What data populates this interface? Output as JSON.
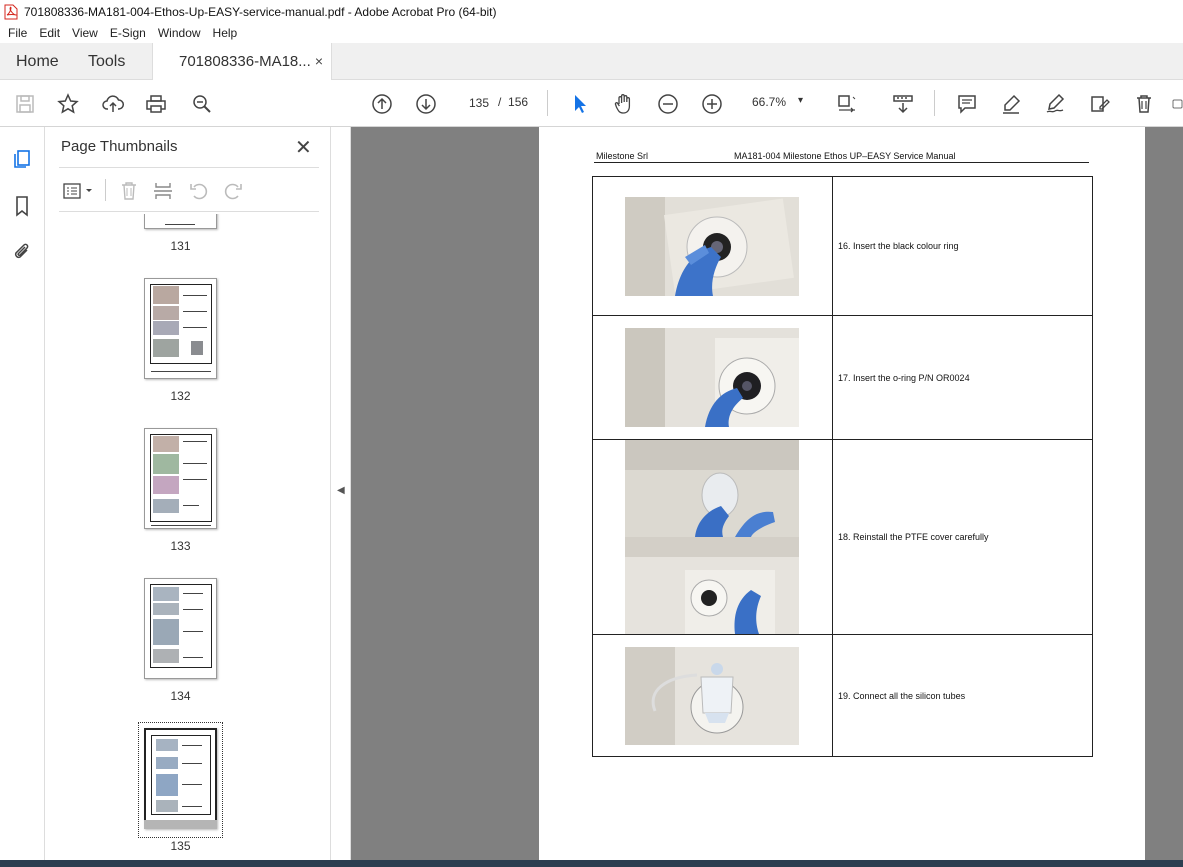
{
  "window": {
    "title": "701808336-MA181-004-Ethos-Up-EASY-service-manual.pdf - Adobe Acrobat Pro (64-bit)"
  },
  "menu": [
    "File",
    "Edit",
    "View",
    "E-Sign",
    "Window",
    "Help"
  ],
  "tabs": {
    "home": "Home",
    "tools": "Tools",
    "document": "701808336-MA18...",
    "close_glyph": "×"
  },
  "toolbar": {
    "current_page": "135",
    "page_separator": "/",
    "total_pages": "156",
    "zoom": "66.7%",
    "zoom_dropdown": "▾"
  },
  "thumbnails_panel": {
    "title": "Page Thumbnails",
    "close_glyph": "✕",
    "pages": [
      {
        "label": "131",
        "selected": false
      },
      {
        "label": "132",
        "selected": false
      },
      {
        "label": "133",
        "selected": false
      },
      {
        "label": "134",
        "selected": false
      },
      {
        "label": "135",
        "selected": true
      }
    ]
  },
  "document": {
    "header_left": "Milestone Srl",
    "header_center": "MA181-004 Milestone Ethos UP–EASY Service Manual",
    "steps": [
      {
        "text": "16.  Insert the black colour ring"
      },
      {
        "text": "17.  Insert the o-ring P/N OR0024"
      },
      {
        "text": "18.  Reinstall the PTFE cover carefully"
      },
      {
        "text": "19.  Connect all the silicon tubes"
      }
    ]
  },
  "icons": {
    "save": "save-icon",
    "bookmark": "star-icon",
    "upload": "upload-icon",
    "print": "print-icon",
    "search": "search-zoom-icon",
    "prev_page": "arrow-up-circle-icon",
    "next_page": "arrow-down-circle-icon",
    "select": "cursor-icon",
    "hand": "hand-icon",
    "zoom_out": "zoom-out-icon",
    "zoom_in": "zoom-in-icon"
  },
  "colors": {
    "accent": "#1473e6",
    "doc_background": "#808080",
    "pdf_red": "#d4261c"
  }
}
